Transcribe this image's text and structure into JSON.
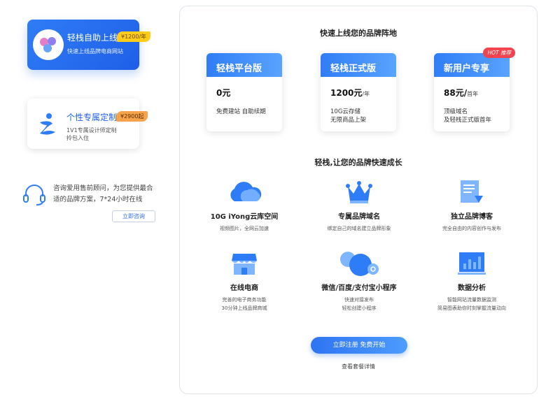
{
  "left": {
    "card1": {
      "title": "轻栈自助上线",
      "price": "¥1200/年",
      "subtitle": "快速上线品牌电商网站"
    },
    "card2": {
      "title": "个性专属定制",
      "price": "¥2900起",
      "line1": "1V1专属设计师定制",
      "line2": "拎包入住"
    },
    "consult": {
      "line1": "咨询爱用售前顾问，为您提供最合",
      "line2": "适的品牌方案，7*24小时在线",
      "button": "立即咨询"
    }
  },
  "main": {
    "title1": "快速上线您的品牌阵地",
    "plans": [
      {
        "name": "轻栈平台版",
        "price": "0元",
        "unit": "",
        "desc1": "免费建站 自助续期",
        "desc2": "",
        "badge": ""
      },
      {
        "name": "轻栈正式版",
        "price": "1200元",
        "unit": "/年",
        "desc1": "10G云存储",
        "desc2": "无限商品上架",
        "badge": ""
      },
      {
        "name": "新用户专享",
        "price": "88元/",
        "unit": "首年",
        "desc1": "顶级域名",
        "desc2": "及轻栈正式版首年",
        "badge": "HOT 推荐"
      }
    ],
    "title2": "轻栈,让您的品牌快速成长",
    "features": [
      {
        "name": "10G iYong云库空间",
        "desc1": "视频图片，全网云加速",
        "desc2": "",
        "icon": "cloud-icon"
      },
      {
        "name": "专属品牌域名",
        "desc1": "绑定自己的域名建立品牌形象",
        "desc2": "",
        "icon": "crown-icon"
      },
      {
        "name": "独立品牌博客",
        "desc1": "完全自由的内容创作与发布",
        "desc2": "",
        "icon": "blog-document-icon"
      },
      {
        "name": "在线电商",
        "desc1": "完善的电子商务功能",
        "desc2": "30分钟上线品牌商城",
        "icon": "shop-icon"
      },
      {
        "name": "微信/百度/支付宝小程序",
        "desc1": "快速对接发布",
        "desc2": "轻松创建小程序",
        "icon": "mini-program-icon"
      },
      {
        "name": "数据分析",
        "desc1": "智能网站流量数据监测",
        "desc2": "简易图表助你时刻掌握流量动向",
        "icon": "chart-icon"
      }
    ],
    "cta": "立即注册  免费开始",
    "more": "查看套餐详情"
  },
  "colors": {
    "accent": "#2f7df6",
    "hot": "#f1444f",
    "tag_yellow": "#ffcc1a",
    "tag_orange": "#f7a34b"
  }
}
